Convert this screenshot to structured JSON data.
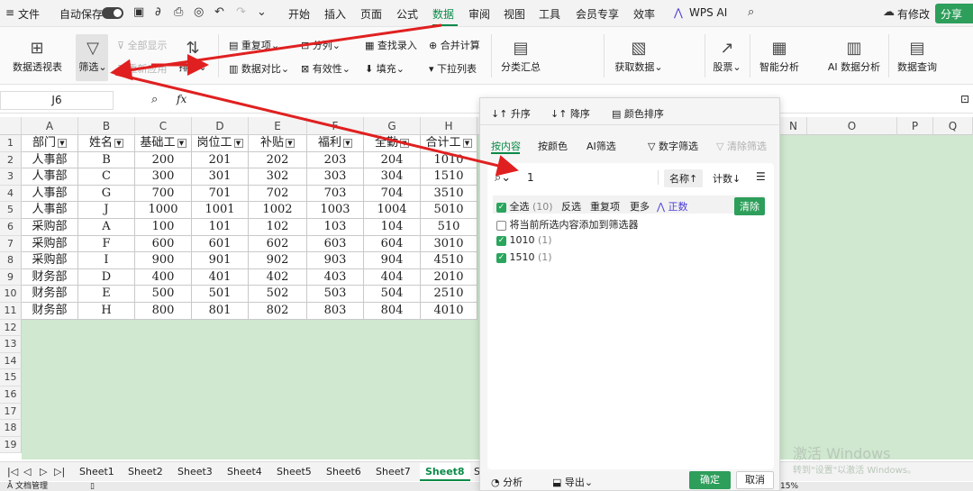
{
  "titlebar": {
    "menu_icon": "≡",
    "file": "文件",
    "autosave": "自动保存",
    "menus": [
      "开始",
      "插入",
      "页面",
      "公式",
      "数据",
      "审阅",
      "视图",
      "工具",
      "会员专享",
      "效率"
    ],
    "ai": "WPS AI",
    "modified": "有修改",
    "share": "分享"
  },
  "ribbon": {
    "pivot": "数据透视表",
    "filter": "筛选",
    "show_all": "全部显示",
    "reapply": "重新应用",
    "sort": "排序",
    "dup": "重复项",
    "compare": "数据对比",
    "split": "分列",
    "validity": "有效性",
    "find_entry": "查找录入",
    "fill": "填充",
    "merge_calc": "合并计算",
    "dropdown_list": "下拉列表",
    "subtotal": "分类汇总",
    "get_data": "获取数据",
    "stock": "股票",
    "smart_analysis": "智能分析",
    "ai_analysis": "AI 数据分析",
    "data_query": "数据查询"
  },
  "formula": {
    "cell_ref": "J6",
    "fx": "fx"
  },
  "columns": [
    "A",
    "B",
    "C",
    "D",
    "E",
    "F",
    "G",
    "H",
    "I",
    "N",
    "O",
    "P",
    "Q"
  ],
  "rows": [
    "1",
    "2",
    "3",
    "4",
    "5",
    "6",
    "7",
    "8",
    "9",
    "10",
    "11",
    "12",
    "13",
    "14",
    "15",
    "16",
    "17",
    "18",
    "19"
  ],
  "headers": [
    "部门",
    "姓名",
    "基础工",
    "岗位工",
    "补贴",
    "福利",
    "全勤",
    "合计工"
  ],
  "table": [
    [
      "人事部",
      "B",
      "200",
      "201",
      "202",
      "203",
      "204",
      "1010"
    ],
    [
      "人事部",
      "C",
      "300",
      "301",
      "302",
      "303",
      "304",
      "1510"
    ],
    [
      "人事部",
      "G",
      "700",
      "701",
      "702",
      "703",
      "704",
      "3510"
    ],
    [
      "人事部",
      "J",
      "1000",
      "1001",
      "1002",
      "1003",
      "1004",
      "5010"
    ],
    [
      "采购部",
      "A",
      "100",
      "101",
      "102",
      "103",
      "104",
      "510"
    ],
    [
      "采购部",
      "F",
      "600",
      "601",
      "602",
      "603",
      "604",
      "3010"
    ],
    [
      "采购部",
      "I",
      "900",
      "901",
      "902",
      "903",
      "904",
      "4510"
    ],
    [
      "财务部",
      "D",
      "400",
      "401",
      "402",
      "403",
      "404",
      "2010"
    ],
    [
      "财务部",
      "E",
      "500",
      "501",
      "502",
      "503",
      "504",
      "2510"
    ],
    [
      "财务部",
      "H",
      "800",
      "801",
      "802",
      "803",
      "804",
      "4010"
    ]
  ],
  "sheets": [
    "Sheet1",
    "Sheet2",
    "Sheet3",
    "Sheet4",
    "Sheet5",
    "Sheet6",
    "Sheet7",
    "Sheet8",
    "S"
  ],
  "active_sheet": "Sheet8",
  "panel": {
    "asc": "升序",
    "desc": "降序",
    "color_sort": "颜色排序",
    "tab_content": "按内容",
    "tab_color": "按颜色",
    "tab_ai": "AI筛选",
    "num_filter": "数字筛选",
    "clear_filter": "清除筛选",
    "search_value": "1",
    "sort_name": "名称↑",
    "sort_count": "计数↓",
    "select_all": "全选",
    "select_all_count": "(10)",
    "invert": "反选",
    "dup_items": "重复项",
    "more": "更多",
    "zhengshu": "正数",
    "clear": "清除",
    "add_to_filter": "将当前所选内容添加到筛选器",
    "items": [
      {
        "label": "1010",
        "count": "(1)"
      },
      {
        "label": "1510",
        "count": "(1)"
      }
    ],
    "analyze": "分析",
    "export": "导出",
    "ok": "确定",
    "cancel": "取消"
  },
  "watermark": {
    "line1": "激活 Windows",
    "line2": "转到\"设置\"以激活 Windows。"
  },
  "status": {
    "left": "Ǡ 文档管理",
    "mid": "▯",
    "zoom": "15%"
  },
  "colors": {
    "accent": "#0a8a48",
    "selection": "#cfe8cf",
    "arrow": "#e02020"
  }
}
